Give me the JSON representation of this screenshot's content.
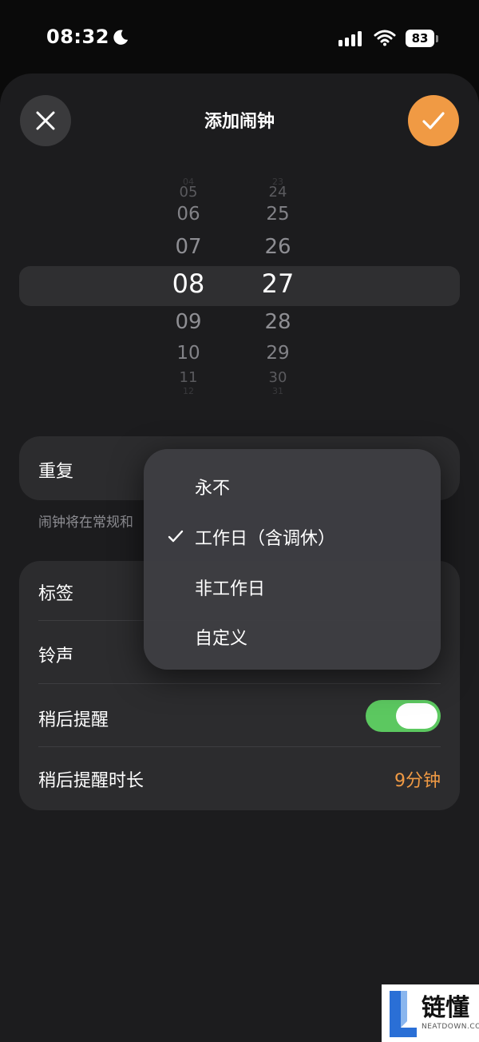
{
  "status_bar": {
    "time": "08:32",
    "battery": "83"
  },
  "header": {
    "title": "添加闹钟"
  },
  "picker": {
    "hours": [
      "04",
      "05",
      "06",
      "07",
      "08",
      "09",
      "10",
      "11",
      "12"
    ],
    "minutes": [
      "23",
      "24",
      "25",
      "26",
      "27",
      "28",
      "29",
      "30",
      "31"
    ],
    "selected_hour": "08",
    "selected_minute": "27"
  },
  "repeat": {
    "label": "重复",
    "footnote": "闹钟将在常规和"
  },
  "settings": {
    "tag_label": "标签",
    "ringtone_label": "铃声",
    "snooze_label": "稍后提醒",
    "snooze_on": true,
    "snooze_duration_label": "稍后提醒时长",
    "snooze_duration_value": "9分钟"
  },
  "repeat_menu": {
    "items": [
      "永不",
      "工作日（含调休）",
      "非工作日",
      "自定义"
    ],
    "selected_index": 1
  },
  "colors": {
    "accent": "#f09a44",
    "toggle_on": "#5cc860",
    "sheet_bg": "#1c1c1e"
  },
  "watermark": {
    "text": "链懂",
    "sub": "NEATDOWN.COM"
  }
}
